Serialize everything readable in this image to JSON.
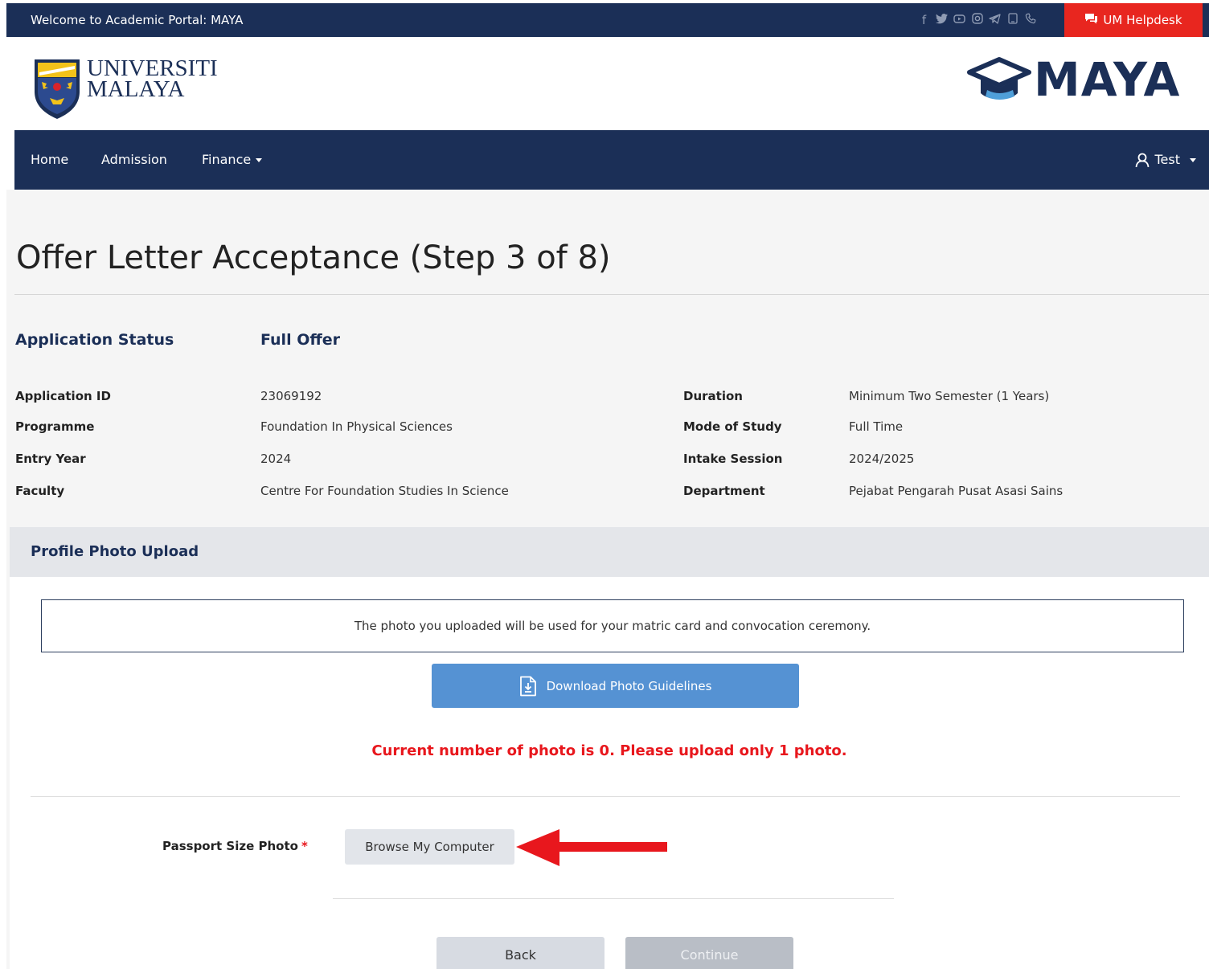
{
  "topbar": {
    "welcome": "Welcome to Academic Portal: MAYA",
    "social_icons": [
      "facebook-icon",
      "twitter-icon",
      "youtube-icon",
      "instagram-icon",
      "telegram-icon",
      "tablet-icon",
      "phone-icon"
    ],
    "helpdesk_label": "UM Helpdesk",
    "helpdesk_color": "#e8261f"
  },
  "brand": {
    "university_line1": "UNIVERSITI",
    "university_line2": "MALAYA",
    "app_logo": "MAYA",
    "brand_color": "#1b2f57"
  },
  "nav": {
    "items": [
      {
        "label": "Home"
      },
      {
        "label": "Admission"
      },
      {
        "label": "Finance"
      }
    ],
    "user_label": "Test"
  },
  "page": {
    "title": "Offer Letter Acceptance (Step 3 of 8)",
    "status_label": "Application Status",
    "status_value": "Full Offer"
  },
  "info": {
    "left": [
      {
        "label": "Application ID",
        "value": "23069192"
      },
      {
        "label": "Programme",
        "value": "Foundation In Physical Sciences"
      },
      {
        "label": "Entry Year",
        "value": "2024"
      },
      {
        "label": "Faculty",
        "value": "Centre For Foundation Studies In Science"
      }
    ],
    "right": [
      {
        "label": "Duration",
        "value": "Minimum Two Semester (1 Years)"
      },
      {
        "label": "Mode of Study",
        "value": "Full Time"
      },
      {
        "label": "Intake Session",
        "value": "2024/2025"
      },
      {
        "label": "Department",
        "value": "Pejabat Pengarah Pusat Asasi Sains"
      }
    ]
  },
  "upload": {
    "panel_title": "Profile Photo Upload",
    "notice": "The photo you uploaded will be used for your matric card and convocation ceremony.",
    "download_label": "Download Photo Guidelines",
    "warning": "Current number of photo is 0. Please upload only 1 photo.",
    "field_label": "Passport Size Photo",
    "required_mark": "*",
    "browse_label": "Browse My Computer",
    "back_label": "Back",
    "continue_label": "Continue",
    "warning_color": "#e8171d"
  }
}
